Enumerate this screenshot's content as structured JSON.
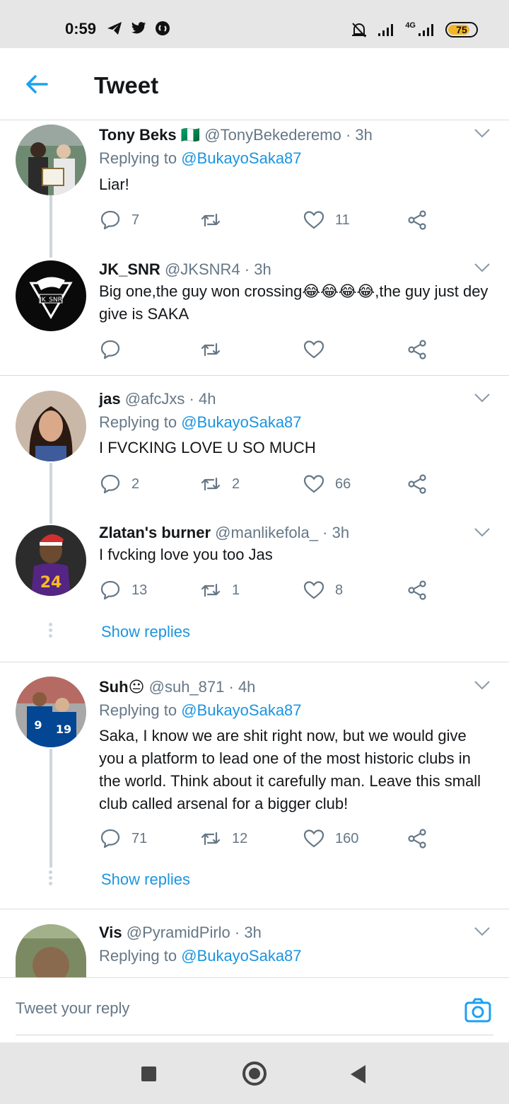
{
  "status_bar": {
    "time": "0:59",
    "network": "4G",
    "battery": "75"
  },
  "header": {
    "title": "Tweet"
  },
  "tweets": [
    {
      "name": "Tony Beks",
      "flag": "🇳🇬",
      "handle": "@TonyBekederemo",
      "time": "· 3h",
      "replying_prefix": "Replying to",
      "replying_to": "@BukayoSaka87",
      "text": "Liar!",
      "replies": "7",
      "retweets": "",
      "likes": "11"
    },
    {
      "name": "JK_SNR",
      "handle": "@JKSNR4",
      "time": "· 3h",
      "text": "Big one,the guy won crossing😂😂😂😂,the guy just dey give is SAKA",
      "replies": "",
      "retweets": "",
      "likes": ""
    },
    {
      "name": "jas",
      "handle": "@afcJxs",
      "time": "· 4h",
      "replying_prefix": "Replying to",
      "replying_to": "@BukayoSaka87",
      "text": "I FVCKING LOVE U SO MUCH",
      "replies": "2",
      "retweets": "2",
      "likes": "66"
    },
    {
      "name": "Zlatan's burner",
      "handle": "@manlikefola_",
      "time": "· 3h",
      "text": "I fvcking love you too Jas",
      "replies": "13",
      "retweets": "1",
      "likes": "8",
      "show_replies": "Show replies"
    },
    {
      "name": "Suh😐",
      "handle": "@suh_871",
      "time": "· 4h",
      "replying_prefix": "Replying to",
      "replying_to": "@BukayoSaka87",
      "text": "Saka, I know we are shit right now, but we would give you a platform to lead one of the most historic clubs in the world. Think about it carefully man. Leave this small club called arsenal for a bigger club!",
      "replies": "71",
      "retweets": "12",
      "likes": "160",
      "show_replies": "Show replies"
    },
    {
      "name": "Vis",
      "handle": "@PyramidPirlo",
      "time": "· 3h",
      "replying_prefix": "Replying to",
      "replying_to": "@BukayoSaka87"
    }
  ],
  "reply_bar": {
    "placeholder": "Tweet your reply"
  },
  "icons": {
    "back": "arrow-left-icon",
    "reply": "speech-bubble-icon",
    "retweet": "retweet-icon",
    "like": "heart-icon",
    "share": "share-icon",
    "menu": "chevron-down-icon",
    "camera": "camera-icon"
  },
  "colors": {
    "accent": "#1da1f2",
    "link": "#1b95e0",
    "muted": "#657786",
    "battery": "#f2b628"
  }
}
